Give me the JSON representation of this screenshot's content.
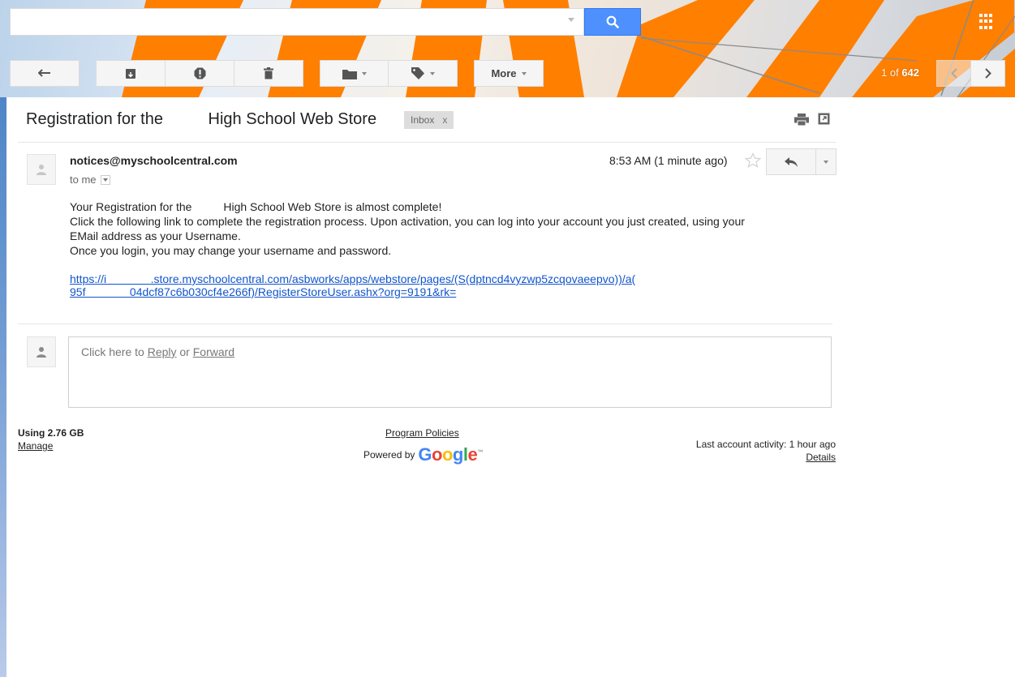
{
  "search": {
    "value": "",
    "placeholder": ""
  },
  "toolbar": {
    "more_label": "More",
    "page_current": "1",
    "page_of": " of ",
    "page_total": "642"
  },
  "message": {
    "subject": "Registration for the          High School Web Store",
    "label": "Inbox",
    "label_close": "x",
    "sender": "notices@myschoolcentral.com",
    "recipient": "to me",
    "time": "8:53 AM (1 minute ago)",
    "body": "Your Registration for the          High School Web Store is almost complete!\nClick the following link to complete the registration process. Upon activation, you can log into your account you just created, using your\nEMail address as your Username.\nOnce you login, you may change your username and password.",
    "link_line1": "https://i              .store.myschoolcentral.com/asbworks/apps/webstore/pages/(S(dptncd4vyzwp5zcqovaeepvo))/a(",
    "link_line2": "95f              04dcf87c6b030cf4e266f)/RegisterStoreUser.ashx?org=9191&rk="
  },
  "reply": {
    "prefix": "Click here to ",
    "reply_link": "Reply",
    "or": " or ",
    "forward_link": "Forward"
  },
  "footer": {
    "storage": "Using 2.76 GB",
    "manage": "Manage",
    "policies": "Program Policies",
    "powered_by": "Powered by",
    "logo_letters": [
      "G",
      "o",
      "o",
      "g",
      "l",
      "e"
    ],
    "logo_tm": "™",
    "activity": "Last account activity: 1 hour ago",
    "details": "Details"
  },
  "colors": {
    "accent_blue": "#4d90fe",
    "link": "#1155cc",
    "theme_orange": "#ff7f00",
    "google": [
      "#4285f4",
      "#ea4335",
      "#fbbc05",
      "#4285f4",
      "#34a853",
      "#ea4335"
    ]
  },
  "icons": [
    "search-icon",
    "apps-icon",
    "back-arrow-icon",
    "archive-icon",
    "spam-icon",
    "trash-icon",
    "folder-icon",
    "tag-icon",
    "prev-page-icon",
    "next-page-icon",
    "print-icon",
    "new-window-icon",
    "person-icon",
    "star-icon",
    "reply-icon",
    "dropdown-icon"
  ]
}
